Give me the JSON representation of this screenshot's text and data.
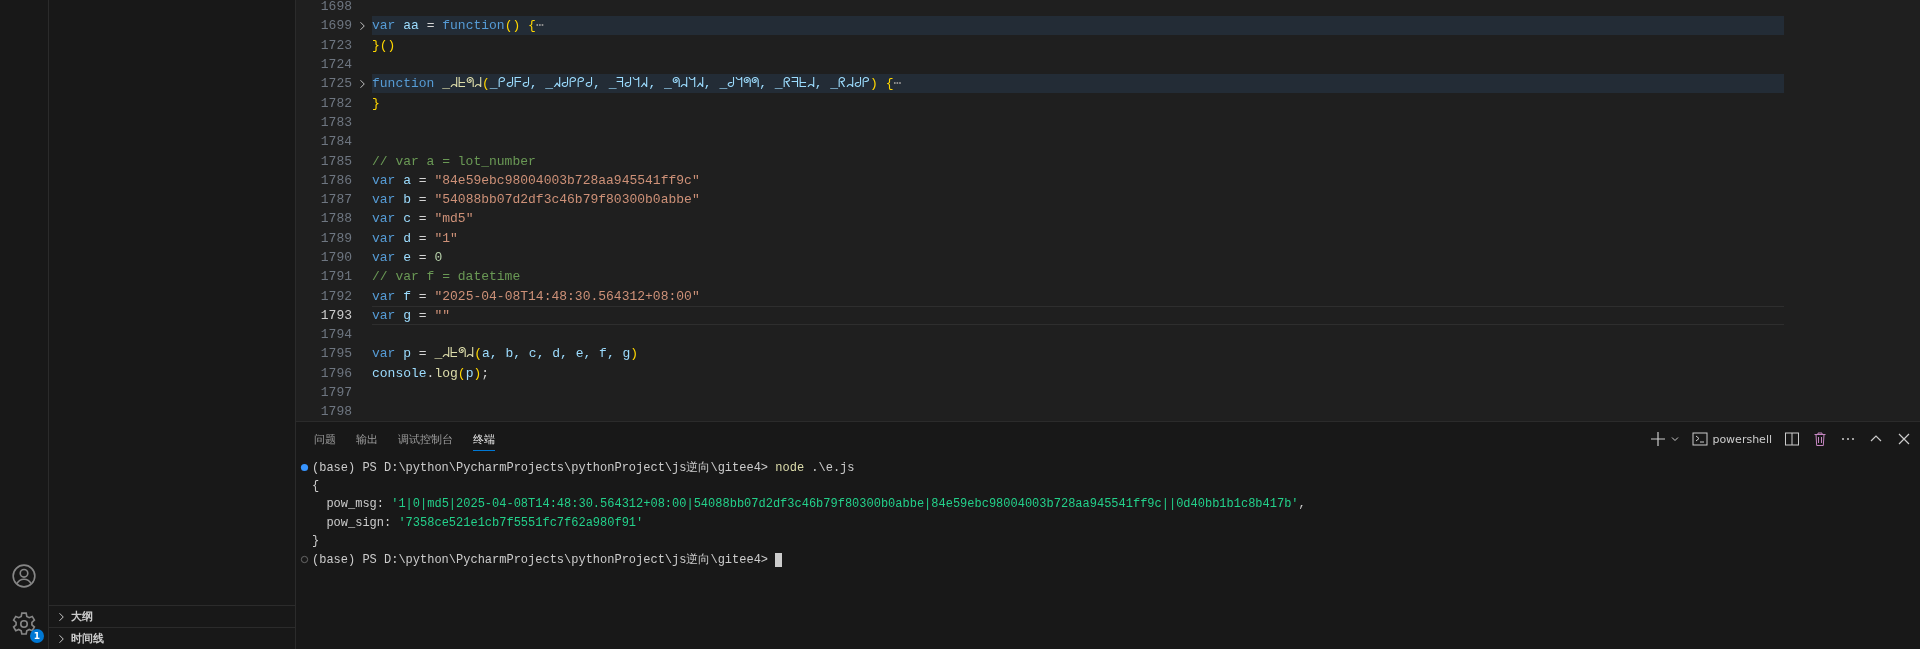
{
  "activity_bar": {
    "settings_badge": "1"
  },
  "sidebar": {
    "sections": [
      {
        "label": "大纲",
        "expanded": false
      },
      {
        "label": "时间线",
        "expanded": false
      }
    ]
  },
  "editor": {
    "lines": [
      {
        "number": "1698",
        "folded": false,
        "current": false
      },
      {
        "number": "1699",
        "folded": true,
        "current": false,
        "tokens": [
          {
            "kind": "kw",
            "text": "var "
          },
          {
            "kind": "id",
            "text": "aa"
          },
          {
            "kind": "op",
            "text": " = "
          },
          {
            "kind": "kw",
            "text": "function"
          },
          {
            "kind": "br",
            "text": "()"
          },
          {
            "kind": "br",
            "text": " {"
          },
          {
            "kind": "fold",
            "text": "⋯"
          }
        ]
      },
      {
        "number": "1723",
        "folded": false,
        "current": false,
        "tokens": [
          {
            "kind": "br",
            "text": "}()"
          }
        ]
      },
      {
        "number": "1724",
        "folded": false,
        "current": false
      },
      {
        "number": "1725",
        "folded": true,
        "current": false,
        "tokens": [
          {
            "kind": "kw",
            "text": "function "
          },
          {
            "kind": "fn",
            "text": "_ᖹᖶᖗᖹ"
          },
          {
            "kind": "br",
            "text": "("
          },
          {
            "kind": "id",
            "text": "_ᑭᑯᖴᑯ, _ᖽᑯᑭᑭᑯ, _ᖷᑯᖻᖽ, _ᖗᖹᖻᖽ, _ᑯᖻᖗᖗ, _ᖇᖷᖶᖹ, _ᖇᖹᑯᑭ"
          },
          {
            "kind": "br",
            "text": ") {"
          },
          {
            "kind": "fold",
            "text": "⋯"
          }
        ]
      },
      {
        "number": "1782",
        "folded": false,
        "current": false,
        "tokens": [
          {
            "kind": "br",
            "text": "}"
          }
        ]
      },
      {
        "number": "1783",
        "folded": false,
        "current": false
      },
      {
        "number": "1784",
        "folded": false,
        "current": false
      },
      {
        "number": "1785",
        "folded": false,
        "current": false,
        "tokens": [
          {
            "kind": "comment",
            "text": "// var a = lot_number"
          }
        ]
      },
      {
        "number": "1786",
        "folded": false,
        "current": false,
        "tokens": [
          {
            "kind": "kw",
            "text": "var "
          },
          {
            "kind": "id",
            "text": "a"
          },
          {
            "kind": "op",
            "text": " = "
          },
          {
            "kind": "str",
            "text": "\"84e59ebc98004003b728aa945541ff9c\""
          }
        ]
      },
      {
        "number": "1787",
        "folded": false,
        "current": false,
        "tokens": [
          {
            "kind": "kw",
            "text": "var "
          },
          {
            "kind": "id",
            "text": "b"
          },
          {
            "kind": "op",
            "text": " = "
          },
          {
            "kind": "str",
            "text": "\"54088bb07d2df3c46b79f80300b0abbe\""
          }
        ]
      },
      {
        "number": "1788",
        "folded": false,
        "current": false,
        "tokens": [
          {
            "kind": "kw",
            "text": "var "
          },
          {
            "kind": "id",
            "text": "c"
          },
          {
            "kind": "op",
            "text": " = "
          },
          {
            "kind": "str",
            "text": "\"md5\""
          }
        ]
      },
      {
        "number": "1789",
        "folded": false,
        "current": false,
        "tokens": [
          {
            "kind": "kw",
            "text": "var "
          },
          {
            "kind": "id",
            "text": "d"
          },
          {
            "kind": "op",
            "text": " = "
          },
          {
            "kind": "str",
            "text": "\"1\""
          }
        ]
      },
      {
        "number": "1790",
        "folded": false,
        "current": false,
        "tokens": [
          {
            "kind": "kw",
            "text": "var "
          },
          {
            "kind": "id",
            "text": "e"
          },
          {
            "kind": "op",
            "text": " = "
          },
          {
            "kind": "num",
            "text": "0"
          }
        ]
      },
      {
        "number": "1791",
        "folded": false,
        "current": false,
        "tokens": [
          {
            "kind": "comment",
            "text": "// var f = datetime"
          }
        ]
      },
      {
        "number": "1792",
        "folded": false,
        "current": false,
        "tokens": [
          {
            "kind": "kw",
            "text": "var "
          },
          {
            "kind": "id",
            "text": "f"
          },
          {
            "kind": "op",
            "text": " = "
          },
          {
            "kind": "str",
            "text": "\"2025-04-08T14:48:30.564312+08:00\""
          }
        ]
      },
      {
        "number": "1793",
        "folded": false,
        "current": true,
        "tokens": [
          {
            "kind": "kw",
            "text": "var "
          },
          {
            "kind": "id",
            "text": "g"
          },
          {
            "kind": "op",
            "text": " = "
          },
          {
            "kind": "str",
            "text": "\"\""
          }
        ]
      },
      {
        "number": "1794",
        "folded": false,
        "current": false
      },
      {
        "number": "1795",
        "folded": false,
        "current": false,
        "tokens": [
          {
            "kind": "kw",
            "text": "var "
          },
          {
            "kind": "id",
            "text": "p"
          },
          {
            "kind": "op",
            "text": " = "
          },
          {
            "kind": "fn",
            "text": "_ᖹᖶᖗᖹ"
          },
          {
            "kind": "br",
            "text": "("
          },
          {
            "kind": "id",
            "text": "a, b, c, d, e, f, g"
          },
          {
            "kind": "br",
            "text": ")"
          }
        ]
      },
      {
        "number": "1796",
        "folded": false,
        "current": false,
        "tokens": [
          {
            "kind": "id",
            "text": "console"
          },
          {
            "kind": "op",
            "text": "."
          },
          {
            "kind": "fn",
            "text": "log"
          },
          {
            "kind": "br",
            "text": "("
          },
          {
            "kind": "id",
            "text": "p"
          },
          {
            "kind": "br",
            "text": ")"
          },
          {
            "kind": "op",
            "text": ";"
          }
        ]
      },
      {
        "number": "1797",
        "folded": false,
        "current": false
      },
      {
        "number": "1798",
        "folded": false,
        "current": false
      }
    ]
  },
  "panel": {
    "tabs": [
      {
        "label": "问题",
        "selected": false
      },
      {
        "label": "输出",
        "selected": false
      },
      {
        "label": "调试控制台",
        "selected": false
      },
      {
        "label": "终端",
        "selected": true
      }
    ],
    "shell": "powershell",
    "terminal": [
      {
        "kind": "command",
        "succeeded": true,
        "cursor": false,
        "tokens": [
          {
            "kind": "plain",
            "text": "(base) PS D:\\python\\PycharmProjects\\pythonProject\\js逆向\\gitee4> "
          },
          {
            "kind": "cmd",
            "text": "node"
          },
          {
            "kind": "plain",
            "text": " .\\e.js"
          }
        ]
      },
      {
        "kind": "output",
        "tokens": [
          {
            "kind": "plain",
            "text": "{"
          }
        ]
      },
      {
        "kind": "output",
        "tokens": [
          {
            "kind": "plain",
            "text": "  pow_msg: "
          },
          {
            "kind": "str",
            "text": "'1|0|md5|2025-04-08T14:48:30.564312+08:00|54088bb07d2df3c46b79f80300b0abbe|84e59ebc98004003b728aa945541ff9c||0d40bb1b1c8b417b'"
          },
          {
            "kind": "plain",
            "text": ","
          }
        ]
      },
      {
        "kind": "output",
        "tokens": [
          {
            "kind": "plain",
            "text": "  pow_sign: "
          },
          {
            "kind": "str",
            "text": "'7358ce521e1cb7f5551fc7f62a980f91'"
          }
        ]
      },
      {
        "kind": "output",
        "tokens": [
          {
            "kind": "plain",
            "text": "}"
          }
        ]
      },
      {
        "kind": "command",
        "succeeded": false,
        "cursor": true,
        "tokens": [
          {
            "kind": "plain",
            "text": "(base) PS D:\\python\\PycharmProjects\\pythonProject\\js逆向\\gitee4> "
          }
        ]
      }
    ]
  }
}
